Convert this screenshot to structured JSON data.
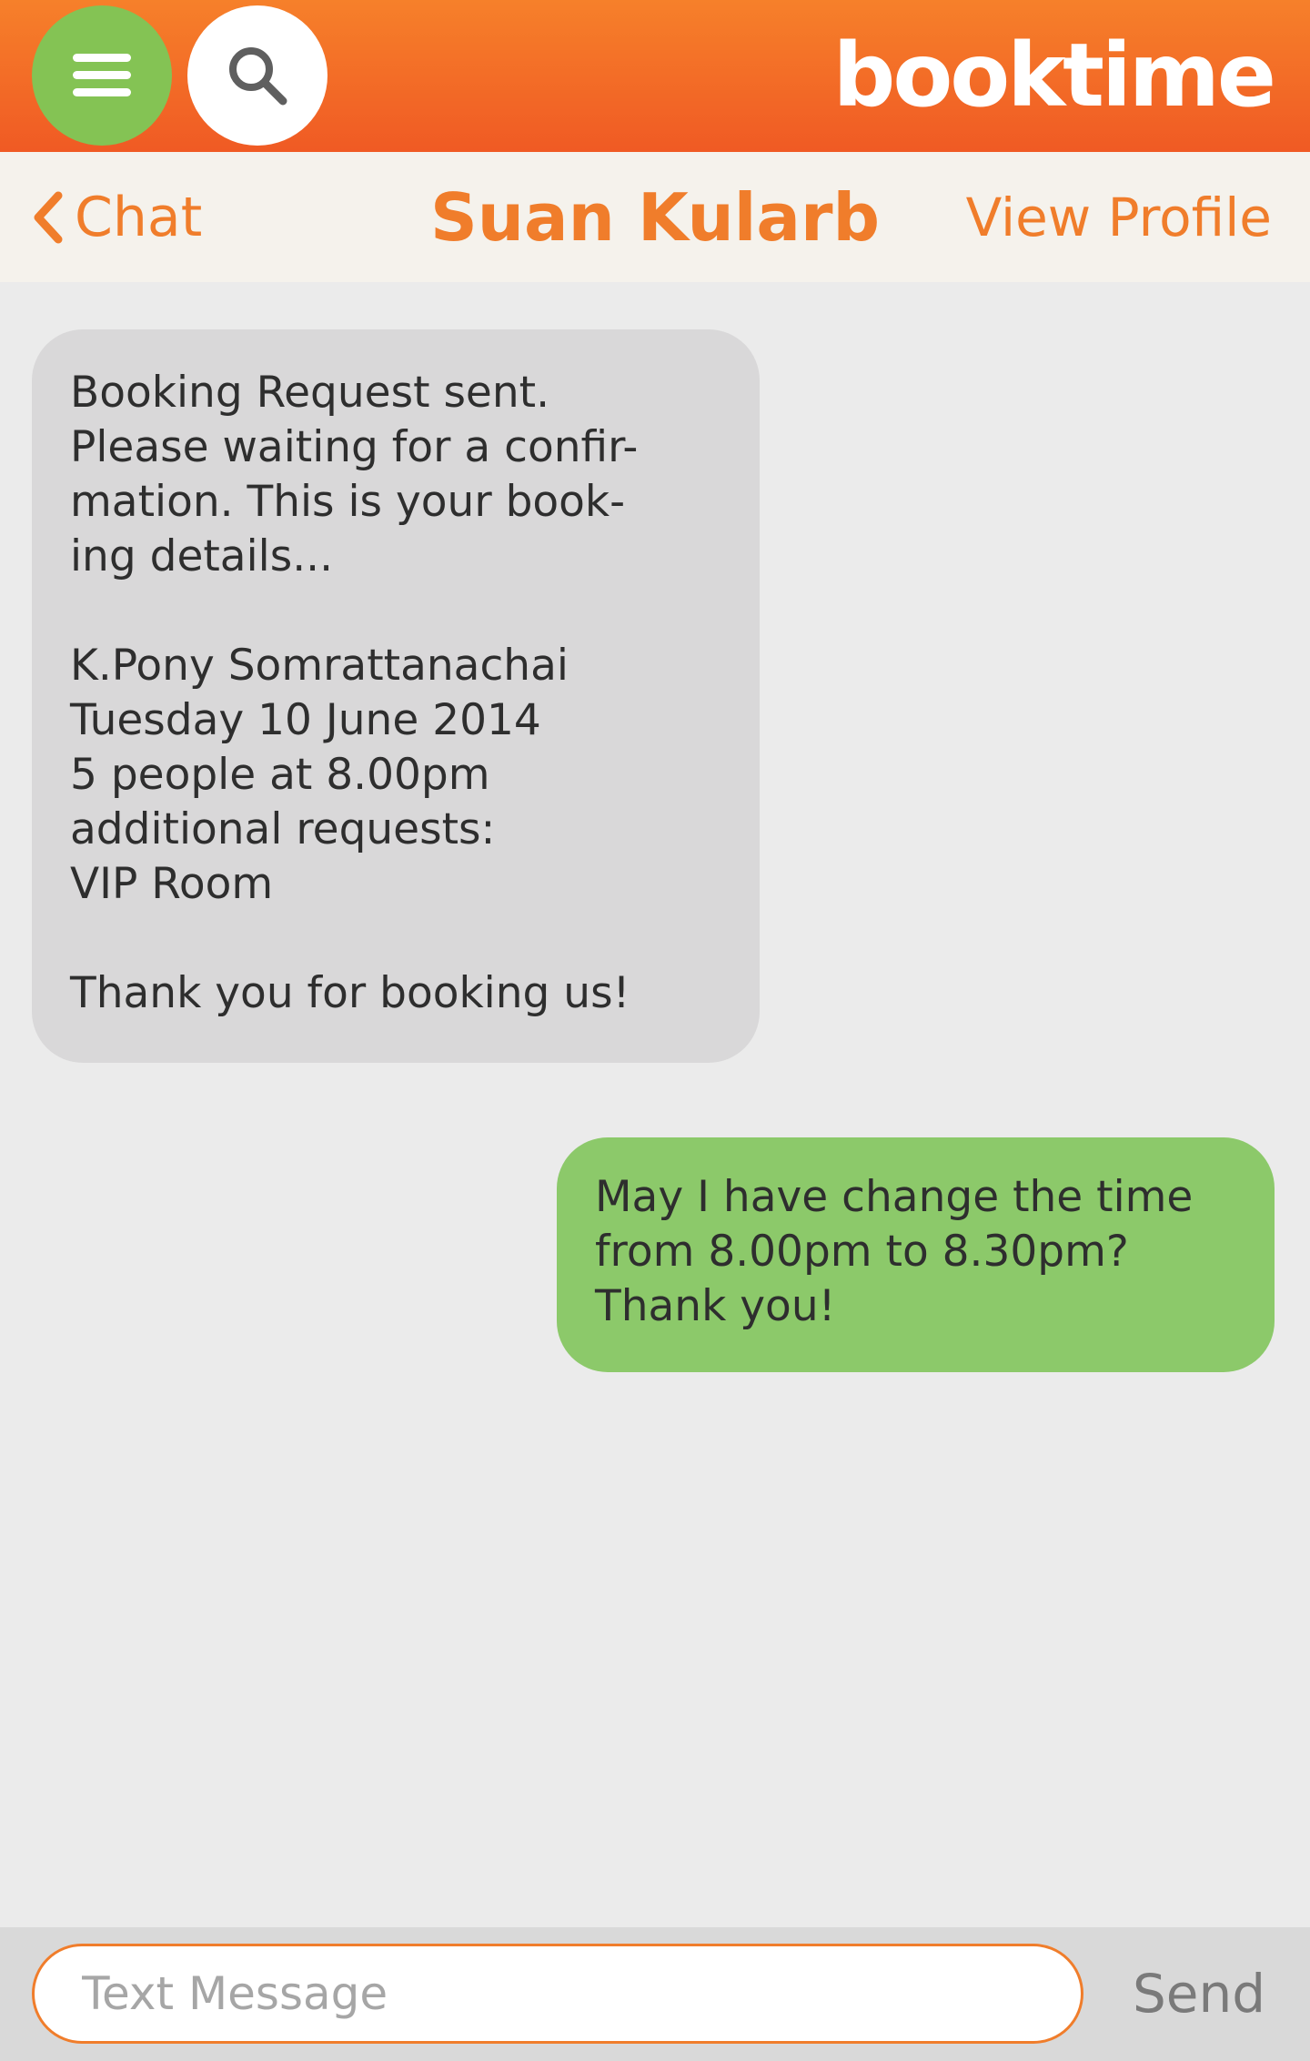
{
  "header": {
    "logo": "booktime",
    "menu_icon": "hamburger-menu-icon",
    "search_icon": "search-icon",
    "colors": {
      "bar": "#f06a26",
      "menu_button": "#84c354",
      "search_button": "#ffffff"
    }
  },
  "nav": {
    "back_label": "Chat",
    "back_icon": "chevron-left-icon",
    "title": "Suan Kularb",
    "view_profile_label": "View Profile",
    "accent": "#f07d2b"
  },
  "messages": [
    {
      "direction": "incoming",
      "text": "Booking Request sent.\nPlease waiting for a confir-\nmation. This is your book-\ning details...\n\nK.Pony Somrattanachai\nTuesday 10 June 2014\n5 people at 8.00pm\nadditional requests:\nVIP Room\n\nThank you for booking us!",
      "color": "#d9d8d9"
    },
    {
      "direction": "outgoing",
      "text": "May I have change the time\nfrom 8.00pm to 8.30pm?\nThank you!",
      "color": "#8cc96a"
    }
  ],
  "composer": {
    "placeholder": "Text Message",
    "value": "",
    "send_label": "Send"
  }
}
